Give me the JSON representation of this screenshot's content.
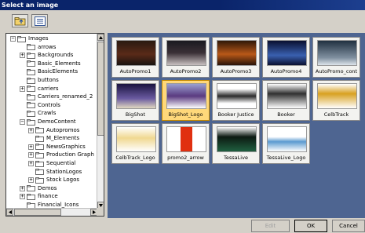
{
  "window": {
    "title": "Select an image"
  },
  "toolbar": {
    "buttons": [
      {
        "icon": "folder-up-icon"
      },
      {
        "icon": "list-view-icon"
      }
    ]
  },
  "tree": {
    "items": [
      {
        "label": "Images",
        "expander": "−"
      },
      {
        "label": "arrows",
        "expander": ""
      },
      {
        "label": "Backgrounds",
        "expander": "+"
      },
      {
        "label": "Basic_Elements",
        "expander": ""
      },
      {
        "label": "BasicElements",
        "expander": ""
      },
      {
        "label": "buttons",
        "expander": ""
      },
      {
        "label": "carriers",
        "expander": "+"
      },
      {
        "label": "Carriers_renamed_2",
        "expander": ""
      },
      {
        "label": "Controls",
        "expander": ""
      },
      {
        "label": "Crawls",
        "expander": ""
      },
      {
        "label": "DemoContent",
        "expander": "−"
      },
      {
        "label": "Autopromos",
        "expander": "+"
      },
      {
        "label": "M_Elements",
        "expander": ""
      },
      {
        "label": "NewsGraphics",
        "expander": "+"
      },
      {
        "label": "Production Graph",
        "expander": "+"
      },
      {
        "label": "Sequential",
        "expander": "+"
      },
      {
        "label": "StationLogos",
        "expander": ""
      },
      {
        "label": "Stock Logos",
        "expander": "+"
      },
      {
        "label": "Demos",
        "expander": "+"
      },
      {
        "label": "finance",
        "expander": "+"
      },
      {
        "label": "Financial_Icons",
        "expander": ""
      }
    ]
  },
  "gallery": {
    "items": [
      {
        "caption": "AutoPromo1",
        "selected": false
      },
      {
        "caption": "AutoPromo2",
        "selected": false
      },
      {
        "caption": "AutoPromo3",
        "selected": false
      },
      {
        "caption": "AutoPromo4",
        "selected": false
      },
      {
        "caption": "AutoPromo_cont",
        "selected": false
      },
      {
        "caption": "BigShot",
        "selected": false
      },
      {
        "caption": "BigShot_Logo",
        "selected": true
      },
      {
        "caption": "Booker Justice",
        "selected": false
      },
      {
        "caption": "Booker",
        "selected": false
      },
      {
        "caption": "CelbTrack",
        "selected": false
      },
      {
        "caption": "CelbTrack_Logo",
        "selected": false
      },
      {
        "caption": "promo2_arrow",
        "selected": false
      },
      {
        "caption": "TessaLive",
        "selected": false
      },
      {
        "caption": "TessaLive_Logo",
        "selected": false
      }
    ]
  },
  "footer": {
    "edit_label": "Edit",
    "ok_label": "OK",
    "cancel_label": "Cancel"
  },
  "colors": {
    "gallery_bg": "#4e6591",
    "selected_thumb": "#ffd87a",
    "titlebar": "#0a246a"
  }
}
